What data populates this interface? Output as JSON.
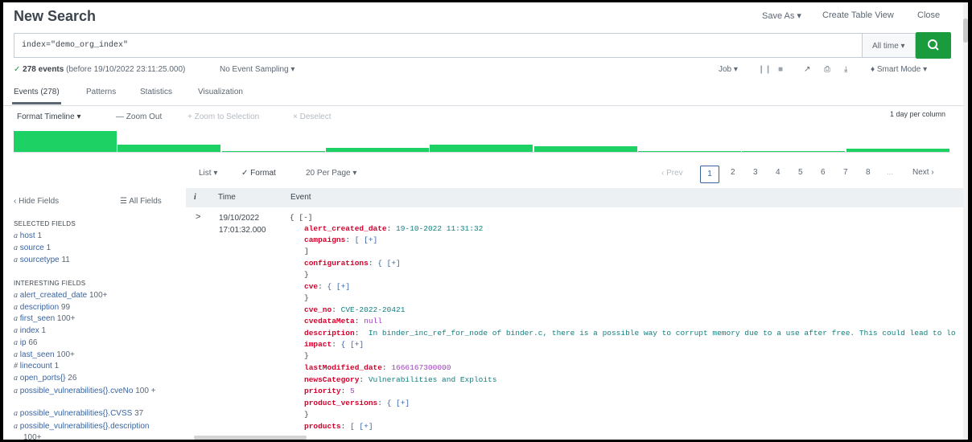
{
  "header": {
    "title": "New Search",
    "save_as": "Save As ▾",
    "create_table_view": "Create Table View",
    "close": "Close"
  },
  "search": {
    "query": "index=\"demo_org_index\"",
    "time_range": "All time ▾"
  },
  "status": {
    "count": "278 events",
    "before": "(before 19/10/2022 23:11:25.000)",
    "sampling": "No Event Sampling ▾",
    "job": "Job ▾",
    "mode": "Smart Mode ▾"
  },
  "tabs": [
    "Events (278)",
    "Patterns",
    "Statistics",
    "Visualization"
  ],
  "timeline": {
    "format": "Format Timeline ▾",
    "zoom_out": "— Zoom Out",
    "zoom_selection": "+ Zoom to Selection",
    "deselect": "× Deselect",
    "scale": "1 day per column",
    "bars": [
      1.0,
      0.35,
      0.05,
      0.2,
      0.35,
      0.25,
      0.05,
      0.05,
      0.15
    ]
  },
  "results_toolbar": {
    "list": "List ▾",
    "format": "✓ Format",
    "per_page": "20 Per Page ▾",
    "prev": "‹ Prev",
    "pages": [
      "1",
      "2",
      "3",
      "4",
      "5",
      "6",
      "7",
      "8"
    ],
    "ellipsis": "...",
    "next": "Next ›"
  },
  "sidebar": {
    "hide_fields": "‹ Hide Fields",
    "all_fields": "☰ All Fields",
    "selected_title": "SELECTED FIELDS",
    "selected": [
      {
        "type": "a",
        "name": "host",
        "count": "1"
      },
      {
        "type": "a",
        "name": "source",
        "count": "1"
      },
      {
        "type": "a",
        "name": "sourcetype",
        "count": "11"
      }
    ],
    "interesting_title": "INTERESTING FIELDS",
    "interesting": [
      {
        "type": "a",
        "name": "alert_created_date",
        "count": "100+"
      },
      {
        "type": "a",
        "name": "description",
        "count": "99"
      },
      {
        "type": "a",
        "name": "first_seen",
        "count": "100+"
      },
      {
        "type": "a",
        "name": "index",
        "count": "1"
      },
      {
        "type": "a",
        "name": "ip",
        "count": "66"
      },
      {
        "type": "a",
        "name": "last_seen",
        "count": "100+"
      },
      {
        "type": "#",
        "name": "linecount",
        "count": "1"
      },
      {
        "type": "a",
        "name": "open_ports{}",
        "count": "26"
      },
      {
        "type": "a",
        "name": "possible_vulnerabilities{}.cveNo",
        "count": "100"
      },
      {
        "type": "a",
        "name": "possible_vulnerabilities{}.CVSS",
        "count": "37"
      },
      {
        "type": "a",
        "name": "possible_vulnerabilities{}.description",
        "count": "100+"
      }
    ]
  },
  "table": {
    "col_i": "i",
    "col_time": "Time",
    "col_event": "Event",
    "row": {
      "expand": ">",
      "date": "19/10/2022",
      "time": "17:01:32.000"
    }
  },
  "event": {
    "open": "{ [-]",
    "alert_created_date_k": "alert_created_date",
    "alert_created_date_v": "19-10-2022 11:31:32",
    "campaigns_k": "campaigns",
    "configurations_k": "configurations",
    "cve_k": "cve",
    "cve_no_k": "cve_no",
    "cve_no_v": "CVE-2022-20421",
    "cvedataMeta_k": "cvedataMeta",
    "cvedataMeta_v": "null",
    "description_k": "description",
    "description_v": "In binder_inc_ref_for_node of binder.c, there is a possible way to corrupt memory due to a use after free. This could lead to lo",
    "impact_k": "impact",
    "lastModified_date_k": "lastModified_date",
    "lastModified_date_v": "1666167300000",
    "newsCategory_k": "newsCategory",
    "newsCategory_v": "Vulnerabilities and Exploits",
    "priority_k": "priority",
    "priority_v": "5",
    "product_versions_k": "product_versions",
    "products_k": "products",
    "expand_arr": "[ [+]",
    "close_arr": "]",
    "expand_obj": "{ [+]",
    "close_obj": "}"
  }
}
